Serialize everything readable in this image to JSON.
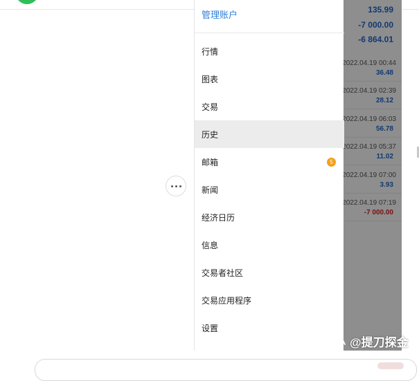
{
  "colors": {
    "accent_link": "#2f7fd8",
    "positive_amount": "#1e63c4",
    "negative_amount": "#d21c1c",
    "badge": "#f3a11a",
    "active_row": "#ececec"
  },
  "drawer": {
    "header_link": "管理账户",
    "items": [
      {
        "label": "行情"
      },
      {
        "label": "图表"
      },
      {
        "label": "交易"
      },
      {
        "label": "历史",
        "active": true
      },
      {
        "label": "邮箱",
        "badge": "5"
      },
      {
        "label": "新闻"
      },
      {
        "label": "经济日历"
      },
      {
        "label": "信息"
      },
      {
        "label": "交易者社区"
      },
      {
        "label": "交易应用程序"
      },
      {
        "label": "设置"
      }
    ]
  },
  "history_background": {
    "summary": [
      "135.99",
      "-7 000.00",
      "-6 864.01"
    ],
    "deals": [
      {
        "time": "2022.04.19 00:44",
        "amount": "36.48"
      },
      {
        "time": "2022.04.19 02:39",
        "amount": "28.12"
      },
      {
        "time": "2022.04.19 06:03",
        "amount": "56.78"
      },
      {
        "time": "2022.04.19 05:37",
        "amount": "11.02"
      },
      {
        "time": "2022.04.19 07:00",
        "amount": "3.93"
      },
      {
        "time": "2022.04.19 07:19",
        "amount": "-7 000.00"
      }
    ]
  },
  "watermark": {
    "text": "@提刀探金",
    "icon": "sound-wave-icon"
  },
  "more_button": {
    "icon": "more-horizontal-icon"
  }
}
